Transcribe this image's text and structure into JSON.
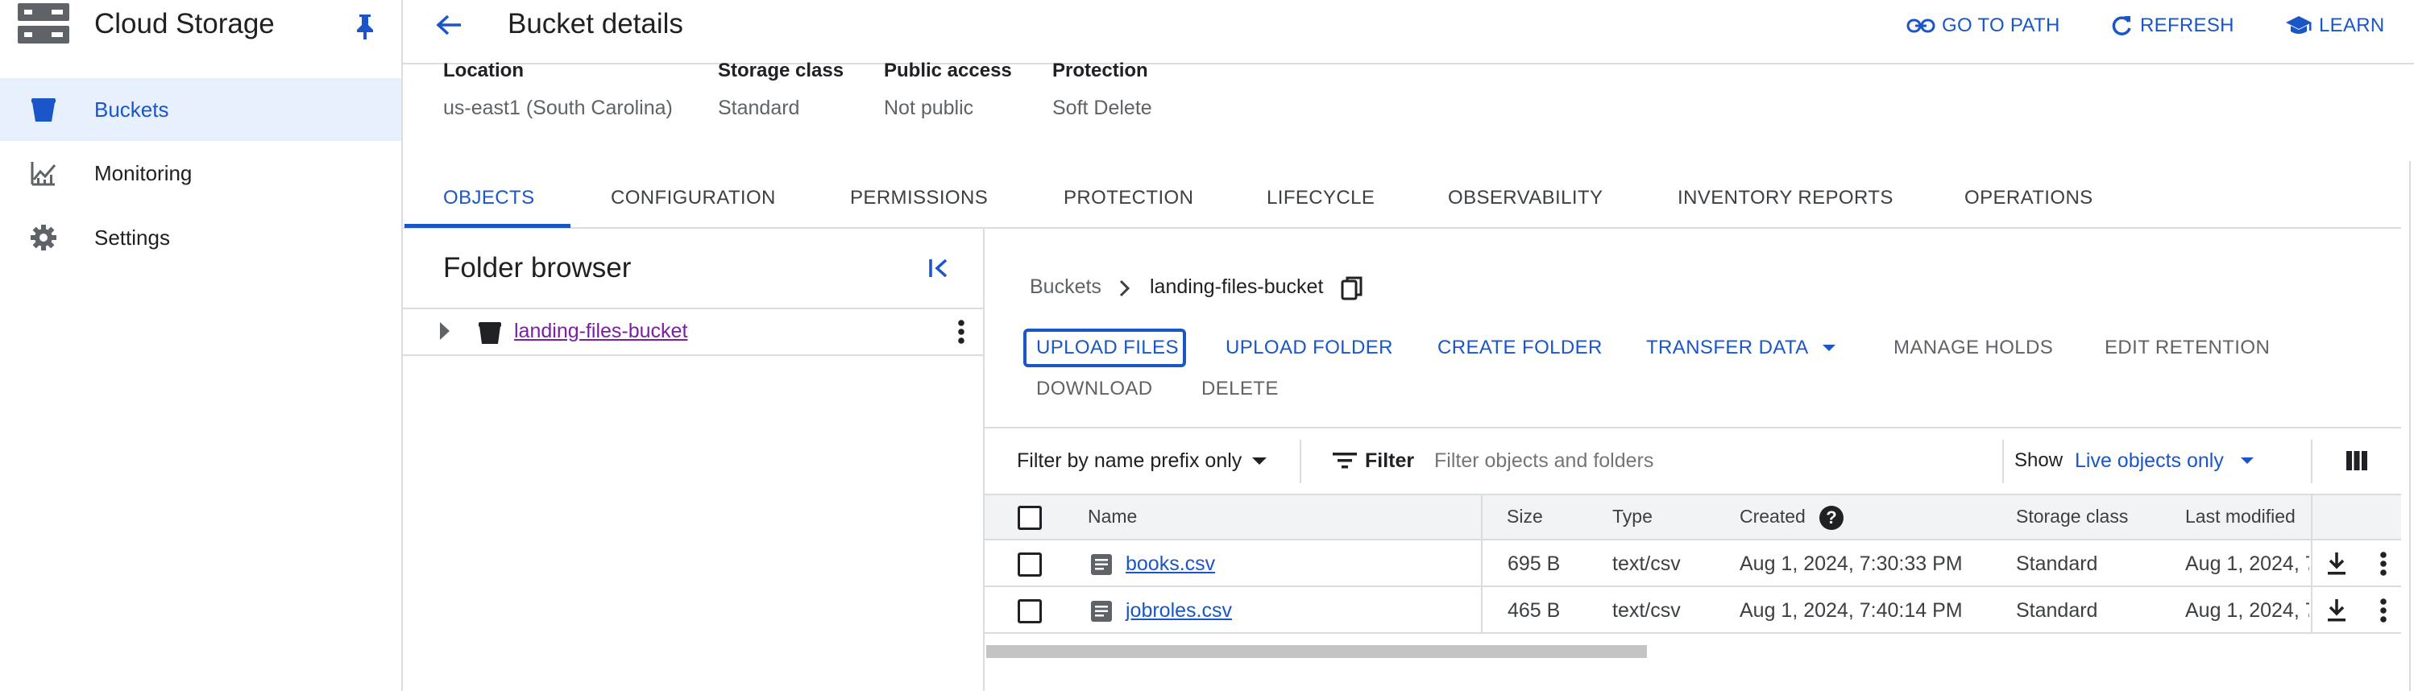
{
  "app": {
    "title": "Cloud Storage",
    "nav": [
      {
        "label": "Buckets",
        "icon": "bucket-icon",
        "active": true
      },
      {
        "label": "Monitoring",
        "icon": "monitoring-icon",
        "active": false
      },
      {
        "label": "Settings",
        "icon": "gear-icon",
        "active": false
      }
    ]
  },
  "header": {
    "title": "Bucket details",
    "actions": {
      "go_to_path": "GO TO PATH",
      "refresh": "REFRESH",
      "learn": "LEARN"
    }
  },
  "bucket_info": {
    "location_label": "Location",
    "location_value": "us-east1 (South Carolina)",
    "storage_class_label": "Storage class",
    "storage_class_value": "Standard",
    "public_access_label": "Public access",
    "public_access_value": "Not public",
    "protection_label": "Protection",
    "protection_value": "Soft Delete"
  },
  "tabs": [
    "OBJECTS",
    "CONFIGURATION",
    "PERMISSIONS",
    "PROTECTION",
    "LIFECYCLE",
    "OBSERVABILITY",
    "INVENTORY REPORTS",
    "OPERATIONS"
  ],
  "folder_browser": {
    "title": "Folder browser",
    "bucket": "landing-files-bucket"
  },
  "breadcrumb": {
    "root": "Buckets",
    "current": "landing-files-bucket"
  },
  "object_actions": {
    "upload_files": "UPLOAD FILES",
    "upload_folder": "UPLOAD FOLDER",
    "create_folder": "CREATE FOLDER",
    "transfer_data": "TRANSFER DATA",
    "manage_holds": "MANAGE HOLDS",
    "edit_retention": "EDIT RETENTION",
    "download": "DOWNLOAD",
    "delete": "DELETE"
  },
  "filter_bar": {
    "prefix_mode": "Filter by name prefix only",
    "filter_label": "Filter",
    "placeholder": "Filter objects and folders",
    "show_label": "Show",
    "show_value": "Live objects only"
  },
  "table": {
    "columns": [
      "Name",
      "Size",
      "Type",
      "Created",
      "Storage class",
      "Last modified"
    ],
    "rows": [
      {
        "name": "books.csv",
        "size": "695 B",
        "type": "text/csv",
        "created": "Aug 1, 2024, 7:30:33 PM",
        "storage_class": "Standard",
        "last_modified": "Aug 1, 2024, 7"
      },
      {
        "name": "jobroles.csv",
        "size": "465 B",
        "type": "text/csv",
        "created": "Aug 1, 2024, 7:40:14 PM",
        "storage_class": "Standard",
        "last_modified": "Aug 1, 2024, 7"
      }
    ]
  }
}
